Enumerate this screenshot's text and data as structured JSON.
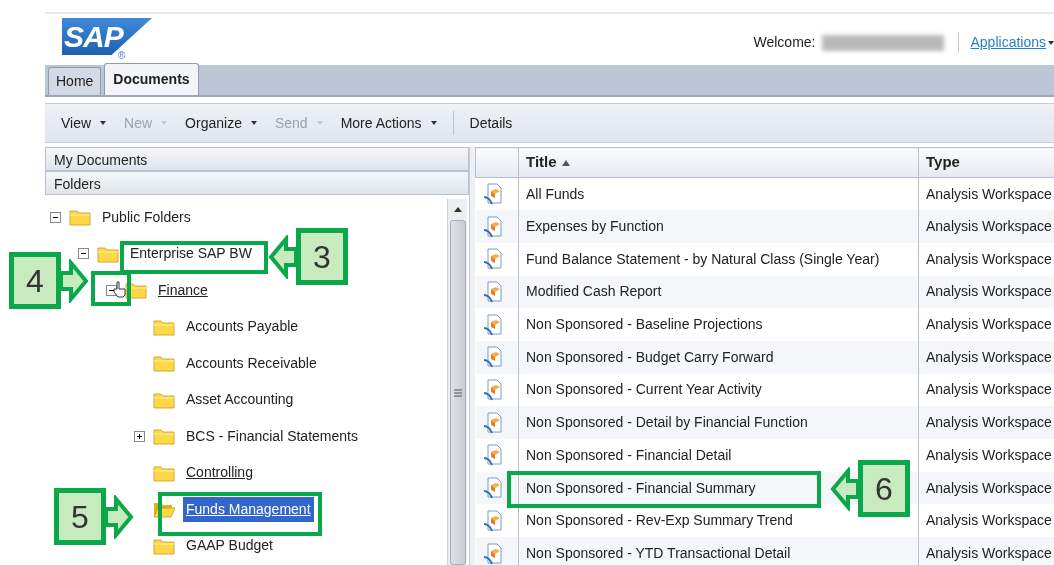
{
  "header": {
    "logo": "SAP",
    "logo_mark": "®",
    "welcome_label": "Welcome:",
    "applications": "Applications"
  },
  "tabs": [
    {
      "label": "Home",
      "selected": false
    },
    {
      "label": "Documents",
      "selected": true
    }
  ],
  "toolbar": [
    {
      "label": "View",
      "disabled": false,
      "dropdown": true
    },
    {
      "label": "New",
      "disabled": true,
      "dropdown": true
    },
    {
      "label": "Organize",
      "disabled": false,
      "dropdown": true
    },
    {
      "label": "Send",
      "disabled": true,
      "dropdown": true
    },
    {
      "label": "More Actions",
      "disabled": false,
      "dropdown": true
    },
    {
      "label": "Details",
      "disabled": false,
      "dropdown": false
    }
  ],
  "left_panel": {
    "sections": [
      "My Documents",
      "Folders"
    ],
    "tree": [
      {
        "label": "Public Folders",
        "expanded": true,
        "selected": false,
        "underlined": false,
        "children": [
          {
            "label": "Enterprise SAP BW",
            "expanded": true,
            "selected": false,
            "underlined": false,
            "children": [
              {
                "label": "Finance",
                "expanded": true,
                "selected": false,
                "underlined": true,
                "children": [
                  {
                    "label": "Accounts Payable",
                    "selected": false,
                    "underlined": false
                  },
                  {
                    "label": "Accounts Receivable",
                    "selected": false,
                    "underlined": false
                  },
                  {
                    "label": "Asset Accounting",
                    "selected": false,
                    "underlined": false
                  },
                  {
                    "label": "BCS - Financial Statements",
                    "expanded": false,
                    "selected": false,
                    "underlined": false
                  },
                  {
                    "label": "Controlling",
                    "selected": false,
                    "underlined": true
                  },
                  {
                    "label": "Funds Management",
                    "selected": true,
                    "underlined": true
                  },
                  {
                    "label": "GAAP Budget",
                    "selected": false,
                    "underlined": false
                  }
                ]
              }
            ]
          }
        ]
      }
    ]
  },
  "documents": {
    "columns": [
      {
        "label": "Title",
        "sort_ascending": true
      },
      {
        "label": "Type"
      }
    ],
    "rows": [
      {
        "title": "All Funds",
        "type": "Analysis Workspace"
      },
      {
        "title": "Expenses by Function",
        "type": "Analysis Workspace"
      },
      {
        "title": "Fund Balance Statement - by Natural Class (Single Year)",
        "type": "Analysis Workspace"
      },
      {
        "title": "Modified Cash Report",
        "type": "Analysis Workspace"
      },
      {
        "title": "Non Sponsored - Baseline Projections",
        "type": "Analysis Workspace"
      },
      {
        "title": "Non Sponsored - Budget Carry Forward",
        "type": "Analysis Workspace"
      },
      {
        "title": "Non Sponsored - Current Year Activity",
        "type": "Analysis Workspace"
      },
      {
        "title": "Non Sponsored - Detail by Financial Function",
        "type": "Analysis Workspace"
      },
      {
        "title": "Non Sponsored - Financial Detail",
        "type": "Analysis Workspace"
      },
      {
        "title": "Non Sponsored - Financial Summary",
        "type": "Analysis Workspace"
      },
      {
        "title": "Non Sponsored - Rev-Exp Summary Trend",
        "type": "Analysis Workspace"
      },
      {
        "title": "Non Sponsored - YTD Transactional Detail",
        "type": "Analysis Workspace"
      }
    ]
  },
  "callouts": [
    {
      "label": "3"
    },
    {
      "label": "4"
    },
    {
      "label": "5"
    },
    {
      "label": "6"
    }
  ]
}
